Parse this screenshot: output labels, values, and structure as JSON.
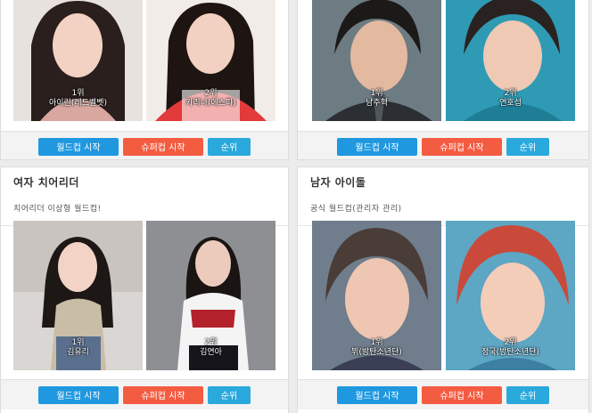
{
  "buttons": {
    "worldcup": "월드컵 시작",
    "supercup": "슈퍼컵 시작",
    "ranking": "순위"
  },
  "cards": [
    {
      "title": "",
      "desc": "",
      "left": {
        "rank": "1위",
        "name": "아이린(레드벨벳)"
      },
      "right": {
        "rank": "2위",
        "name": "카리나(에스파)"
      }
    },
    {
      "title": "",
      "desc": "",
      "left": {
        "rank": "1위",
        "name": "남주혁"
      },
      "right": {
        "rank": "2위",
        "name": "연호섭"
      }
    },
    {
      "title": "여자 치어리더",
      "desc": "치어리더 이상형 월드컵!",
      "left": {
        "rank": "1위",
        "name": "김유리"
      },
      "right": {
        "rank": "2위",
        "name": "김연아"
      }
    },
    {
      "title": "남자 아이돌",
      "desc": "공식 월드컵(관리자 관리)",
      "left": {
        "rank": "1위",
        "name": "뷔(방탄소년단)"
      },
      "right": {
        "rank": "2위",
        "name": "정국(방탄소년단)"
      }
    }
  ],
  "colors": {
    "worldcup_btn": "#1f98e0",
    "supercup_btn": "#f45c42",
    "ranking_btn": "#2aa9dc"
  }
}
